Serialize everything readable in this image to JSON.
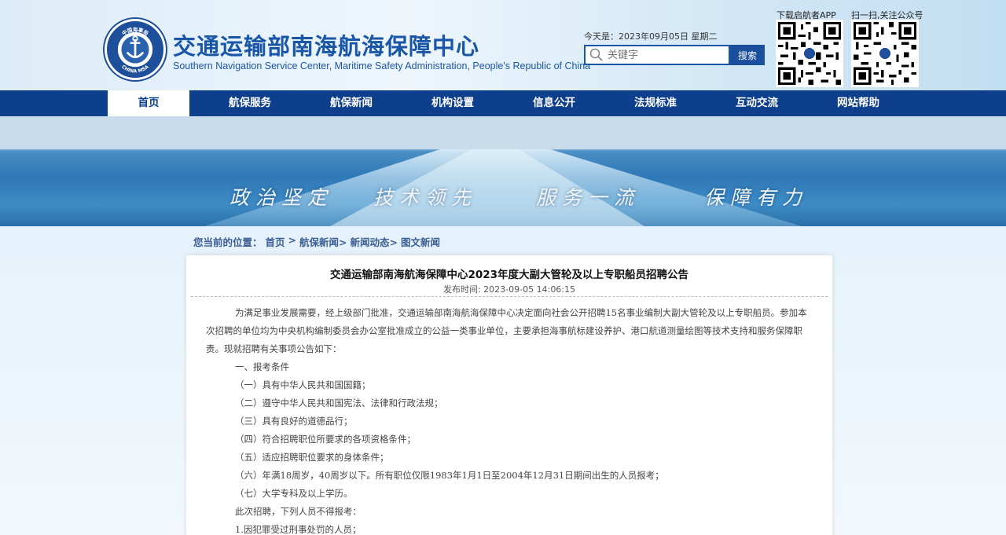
{
  "header": {
    "title": "交通运输部南海航海保障中心",
    "subtitle": "Southern Navigation Service Center, Maritime Safety Administration, People's Republic of China",
    "emblem_top_text": "中国海事局",
    "emblem_bottom_text": "CHINA MSA",
    "date_label": "今天是：",
    "date_value": "2023年09月05日 星期二",
    "search_placeholder": "关键字",
    "search_button": "搜索",
    "qr_app_label": "下载启航者APP",
    "qr_wechat_label": "扫一扫,关注公众号"
  },
  "nav": {
    "items": [
      {
        "label": "首页",
        "active": true
      },
      {
        "label": "航保服务"
      },
      {
        "label": "航保新闻"
      },
      {
        "label": "机构设置"
      },
      {
        "label": "信息公开"
      },
      {
        "label": "法规标准"
      },
      {
        "label": "互动交流"
      },
      {
        "label": "网站帮助"
      }
    ]
  },
  "banner": {
    "slogans": [
      "政治坚定",
      "技术领先",
      "服务一流",
      "保障有力"
    ]
  },
  "breadcrumb": {
    "label": "您当前的位置：",
    "items": [
      "首页",
      "航保新闻>",
      "新闻动态>",
      "图文新闻"
    ],
    "separator": ">"
  },
  "article": {
    "title": "交通运输部南海航海保障中心2023年度大副大管轮及以上专职船员招聘公告",
    "published": "发布时间: 2023-09-05 14:06:15",
    "intro": "为满足事业发展需要，经上级部门批准，交通运输部南海航海保障中心决定面向社会公开招聘15名事业编制大副大管轮及以上专职船员。参加本次招聘的单位均为中央机构编制委员会办公室批准成立的公益一类事业单位，主要承担海事航标建设养护、港口航道测量绘图等技术支持和服务保障职责。现就招聘有关事项公告如下：",
    "section1": "一、报考条件",
    "conditions": [
      "（一）具有中华人民共和国国籍；",
      "（二）遵守中华人民共和国宪法、法律和行政法规；",
      "（三）具有良好的道德品行；",
      "（四）符合招聘职位所要求的各项资格条件；",
      "（五）适应招聘职位要求的身体条件；",
      "（六）年满18周岁，40周岁以下。所有职位仅限1983年1月1日至2004年12月31日期间出生的人员报考；",
      "（七）大学专科及以上学历。"
    ],
    "exclusion_intro": "此次招聘，下列人员不得报考：",
    "exclusions": [
      "1.因犯罪受过刑事处罚的人员；"
    ]
  }
}
